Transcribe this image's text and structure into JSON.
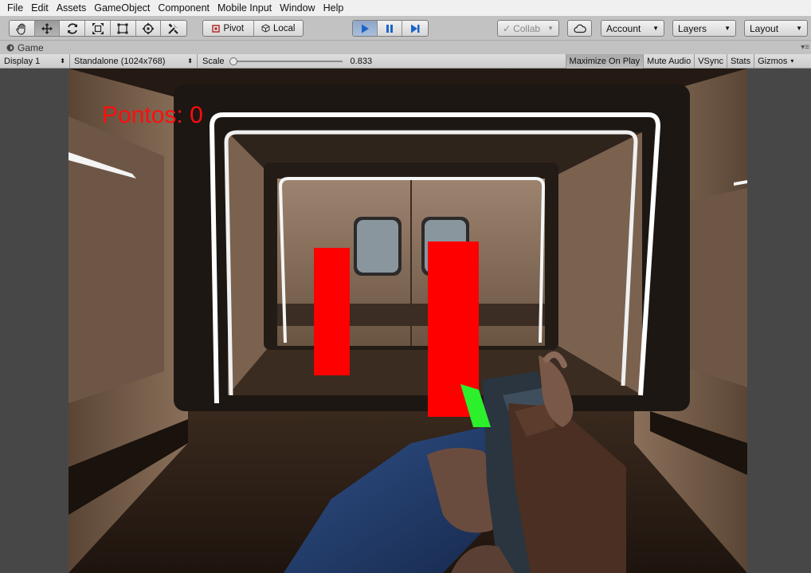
{
  "menu": {
    "items": [
      "File",
      "Edit",
      "Assets",
      "GameObject",
      "Component",
      "Mobile Input",
      "Window",
      "Help"
    ]
  },
  "toolbar": {
    "transform_tools": [
      "hand-tool-icon",
      "move-tool-icon",
      "rotate-tool-icon",
      "scale-tool-icon",
      "rect-tool-icon",
      "transform-tool-icon",
      "custom-tool-icon"
    ],
    "pivot_label": "Pivot",
    "local_label": "Local",
    "collab_label": "Collab",
    "account_label": "Account",
    "layers_label": "Layers",
    "layout_label": "Layout",
    "play_state": "playing"
  },
  "game_tab": {
    "title": "Game"
  },
  "game_bar": {
    "display": "Display 1",
    "resolution": "Standalone (1024x768)",
    "scale_label": "Scale",
    "scale_value": "0.833",
    "maximize_label": "Maximize On Play",
    "mute_label": "Mute Audio",
    "vsync_label": "VSync",
    "stats_label": "Stats",
    "gizmos_label": "Gizmos"
  },
  "game": {
    "score_text": "Pontos: 0",
    "colors": {
      "target": "#ff0000",
      "ammo_clip": "#2cf02c",
      "frame_light": "#ffffff",
      "score_text": "#ff0d0d"
    }
  }
}
